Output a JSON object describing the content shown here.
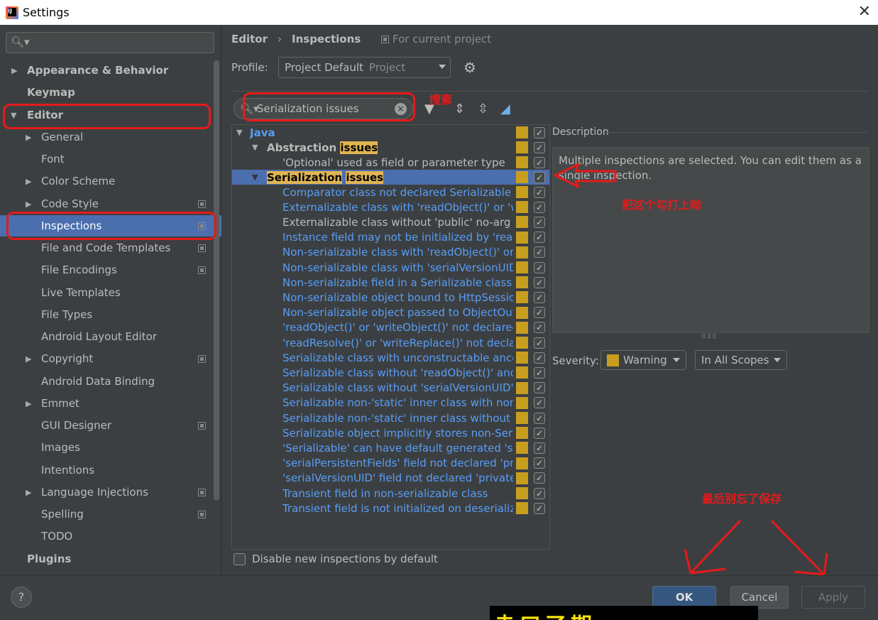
{
  "window": {
    "title": "Settings",
    "close_glyph": "✕"
  },
  "sidebar": {
    "search_placeholder": "",
    "items": [
      {
        "label": "Appearance & Behavior"
      },
      {
        "label": "Keymap"
      },
      {
        "label": "Editor"
      },
      {
        "label": "General"
      },
      {
        "label": "Font"
      },
      {
        "label": "Color Scheme"
      },
      {
        "label": "Code Style"
      },
      {
        "label": "Inspections"
      },
      {
        "label": "File and Code Templates"
      },
      {
        "label": "File Encodings"
      },
      {
        "label": "Live Templates"
      },
      {
        "label": "File Types"
      },
      {
        "label": "Android Layout Editor"
      },
      {
        "label": "Copyright"
      },
      {
        "label": "Android Data Binding"
      },
      {
        "label": "Emmet"
      },
      {
        "label": "GUI Designer"
      },
      {
        "label": "Images"
      },
      {
        "label": "Intentions"
      },
      {
        "label": "Language Injections"
      },
      {
        "label": "Spelling"
      },
      {
        "label": "TODO"
      },
      {
        "label": "Plugins"
      }
    ]
  },
  "header": {
    "breadcrumb_1": "Editor",
    "breadcrumb_sep": "›",
    "breadcrumb_2": "Inspections",
    "for_project": "For current project",
    "profile_label": "Profile:",
    "profile_value": "Project Default",
    "profile_secondary": "Project"
  },
  "filter": {
    "search_value": "Serialization issues"
  },
  "annotations": {
    "search_note": "搜索",
    "check_note": "把这个勾打上呦",
    "save_note": "最后别忘了保存",
    "bottom_strip": "赤口了期"
  },
  "inspection_tree": {
    "java": "Java",
    "abstraction_prefix": "Abstraction",
    "abstraction_hl": "issues",
    "optional_item": "'Optional' used as field or parameter type",
    "serialization_prefix": "Serialization",
    "serialization_hl": "issues",
    "items": [
      "Comparator class not declared Serializable",
      "Externalizable class with 'readObject()' or 'wr",
      "Externalizable class without 'public' no-arg co",
      "Instance field may not be initialized by 'readO",
      "Non-serializable class with 'readObject()' or 'w",
      "Non-serializable class with 'serialVersionUID'",
      "Non-serializable field in a Serializable class",
      "Non-serializable object bound to HttpSessio",
      "Non-serializable object passed to ObjectOut",
      "'readObject()' or 'writeObject()' not declared",
      "'readResolve()' or 'writeReplace()' not declar",
      "Serializable class with unconstructable ances",
      "Serializable class without 'readObject()' and '",
      "Serializable class without 'serialVersionUID'",
      "Serializable non-'static' inner class with non-S",
      "Serializable non-'static' inner class without 'se",
      "Serializable object implicitly stores non-Seria",
      "'Serializable' can have default generated 'seri",
      "'serialPersistentFields' field not declared 'priv",
      "'serialVersionUID' field not declared 'private",
      "Transient field in non-serializable class",
      "Transient field is not initialized on deserializa"
    ],
    "black_items": [
      2
    ],
    "check_glyph": "✓",
    "disable_label": "Disable new inspections by default"
  },
  "description": {
    "label": "Description",
    "text": "Multiple inspections are selected. You can edit them as a single inspection.",
    "handle": "⠿⠿⠿",
    "severity_label": "Severity:",
    "severity_value": "Warning",
    "scope_value": "In All Scopes"
  },
  "buttons": {
    "help": "?",
    "ok": "OK",
    "cancel": "Cancel",
    "apply": "Apply"
  },
  "colors": {
    "accent": "#4b6eaf",
    "link": "#589df6",
    "warning": "#c89e1f",
    "annotation": "#e61a1a",
    "highlight": "#e0b552"
  }
}
